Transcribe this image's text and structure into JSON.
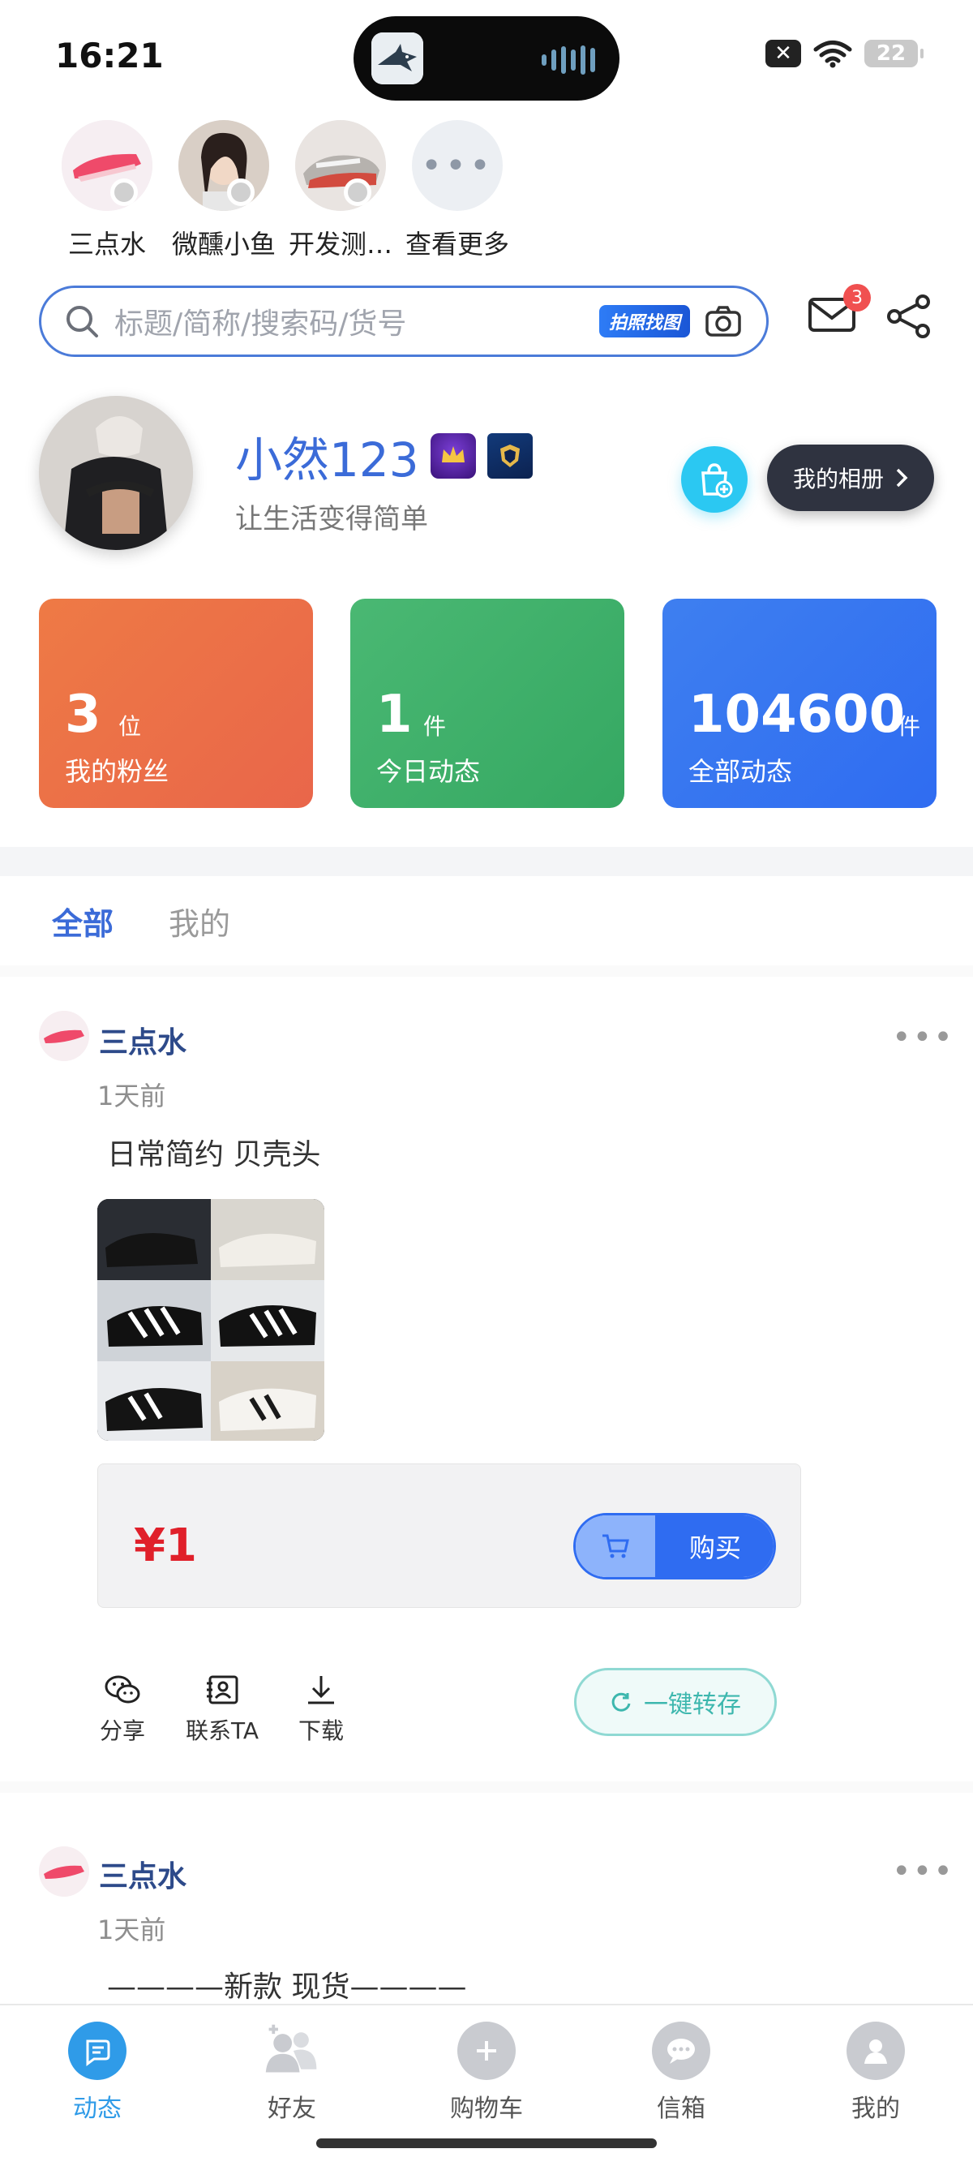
{
  "status_bar": {
    "time": "16:21",
    "battery": "22"
  },
  "friends": [
    {
      "name": "三点水"
    },
    {
      "name": "微醺小鱼"
    },
    {
      "name": "开发测…"
    },
    {
      "name": "查看更多",
      "more_glyph": "•••"
    }
  ],
  "search": {
    "placeholder": "标题/简称/搜索码/货号",
    "photo_badge": "拍照找图"
  },
  "mail": {
    "badge_count": "3"
  },
  "profile": {
    "username": "小然123",
    "bio": "让生活变得简单",
    "album_button": "我的相册"
  },
  "stats": [
    {
      "number": "3",
      "unit": "位",
      "label": "我的粉丝"
    },
    {
      "number": "1",
      "unit": "件",
      "label": "今日动态"
    },
    {
      "number": "104600",
      "unit": "件",
      "label": "全部动态"
    }
  ],
  "tabs": [
    {
      "label": "全部"
    },
    {
      "label": "我的"
    }
  ],
  "posts": [
    {
      "author": "三点水",
      "time": "1天前",
      "text": "日常简约 贝壳头",
      "price": "¥1",
      "buy_label": "购买",
      "more": "•••",
      "actions": [
        {
          "label": "分享"
        },
        {
          "label": "联系TA"
        },
        {
          "label": "下载"
        }
      ],
      "transfer_label": "一键转存"
    },
    {
      "author": "三点水",
      "time": "1天前",
      "text": "————新款 现货————",
      "more": "•••"
    }
  ],
  "bottom_nav": [
    {
      "label": "动态",
      "icon": "feed-icon",
      "active": true
    },
    {
      "label": "好友",
      "icon": "friends-icon"
    },
    {
      "label": "购物车",
      "icon": "cart-plus-icon"
    },
    {
      "label": "信箱",
      "icon": "chat-icon"
    },
    {
      "label": "我的",
      "icon": "person-icon"
    }
  ],
  "colors": {
    "accent": "#3b6bd8",
    "fans_card": "#ee7a45",
    "today_card": "#4ab873",
    "all_card": "#3e7ff0",
    "price": "#e0202a",
    "nav_active": "#2f9be8"
  }
}
